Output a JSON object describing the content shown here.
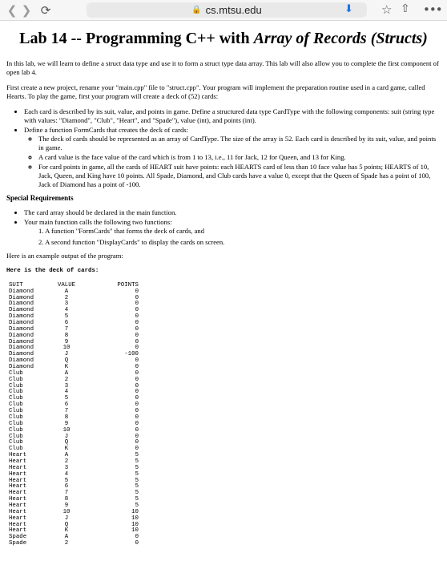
{
  "browser": {
    "url": "cs.mtsu.edu",
    "icons": [
      "back-icon",
      "forward-icon",
      "reload-icon",
      "lock-icon",
      "download-icon",
      "bookmark-star-icon",
      "share-icon",
      "more-icon"
    ]
  },
  "doc": {
    "title_main": "Lab 14 -- Programming C++ with ",
    "title_em": "Array of Records (Structs)",
    "intro": "In this lab, we will learn to define a struct data type and use it to form a struct type data array. This lab will also allow you to complete the first component of open lab 4.",
    "first": "First create a new project, rename your \"main.cpp\" file to \"struct.cpp\". Your program will implement the preparation routine used in a card game, called Hearts. To play the game, first your program will create a deck of (52) cards:",
    "bullet1": "Each card is described by its suit, value, and points in game. Define a structured data type CardType with the following components: suit (string type with values: \"Diamond\", \"Club\", \"Heart\", and \"Spade\"), value (int), and points (int).",
    "bullet2": "Define a function FormCards that creates the deck of cards:",
    "sub1": "The deck of cards should be represented as an array of CardType. The size of the array is 52. Each card is described by its suit, value, and points in game.",
    "sub2": "A card value is the face value of the card which is from 1 to 13, i.e., 11 for Jack, 12 for Queen, and 13 for King.",
    "sub3": "For card points in game, all the cards of HEART suit have points: each HEARTS card of less than 10 face value has 5 points; HEARTS of 10, Jack, Queen, and King have 10 points. All Spade, Diamond, and Club cards have a value 0, except that the Queen of Spade has a point of 100, Jack of Diamond has a point of -100.",
    "special_heading": "Special Requirements",
    "req1": "The card array should be declared in the main function.",
    "req2": "Your main function calls the following two functions:",
    "fn1": "1.  A function \"FormCards\" that forms the deck of cards, and",
    "fn2": "2.  A second function \"DisplayCards\" to display the cards on screen.",
    "example": "Here is an example output of the program:"
  },
  "output": {
    "heading": "Here is the deck of cards:",
    "columns": [
      "SUIT",
      "VALUE",
      "POINTS"
    ],
    "rows": [
      [
        "Diamond",
        "A",
        "0"
      ],
      [
        "Diamond",
        "2",
        "0"
      ],
      [
        "Diamond",
        "3",
        "0"
      ],
      [
        "Diamond",
        "4",
        "0"
      ],
      [
        "Diamond",
        "5",
        "0"
      ],
      [
        "Diamond",
        "6",
        "0"
      ],
      [
        "Diamond",
        "7",
        "0"
      ],
      [
        "Diamond",
        "8",
        "0"
      ],
      [
        "Diamond",
        "9",
        "0"
      ],
      [
        "Diamond",
        "10",
        "0"
      ],
      [
        "Diamond",
        "J",
        "-100"
      ],
      [
        "Diamond",
        "Q",
        "0"
      ],
      [
        "Diamond",
        "K",
        "0"
      ],
      [
        "Club",
        "A",
        "0"
      ],
      [
        "Club",
        "2",
        "0"
      ],
      [
        "Club",
        "3",
        "0"
      ],
      [
        "Club",
        "4",
        "0"
      ],
      [
        "Club",
        "5",
        "0"
      ],
      [
        "Club",
        "6",
        "0"
      ],
      [
        "Club",
        "7",
        "0"
      ],
      [
        "Club",
        "8",
        "0"
      ],
      [
        "Club",
        "9",
        "0"
      ],
      [
        "Club",
        "10",
        "0"
      ],
      [
        "Club",
        "J",
        "0"
      ],
      [
        "Club",
        "Q",
        "0"
      ],
      [
        "Club",
        "K",
        "0"
      ],
      [
        "Heart",
        "A",
        "5"
      ],
      [
        "Heart",
        "2",
        "5"
      ],
      [
        "Heart",
        "3",
        "5"
      ],
      [
        "Heart",
        "4",
        "5"
      ],
      [
        "Heart",
        "5",
        "5"
      ],
      [
        "Heart",
        "6",
        "5"
      ],
      [
        "Heart",
        "7",
        "5"
      ],
      [
        "Heart",
        "8",
        "5"
      ],
      [
        "Heart",
        "9",
        "5"
      ],
      [
        "Heart",
        "10",
        "10"
      ],
      [
        "Heart",
        "J",
        "10"
      ],
      [
        "Heart",
        "Q",
        "10"
      ],
      [
        "Heart",
        "K",
        "10"
      ],
      [
        "Spade",
        "A",
        "0"
      ],
      [
        "Spade",
        "2",
        "0"
      ]
    ]
  }
}
